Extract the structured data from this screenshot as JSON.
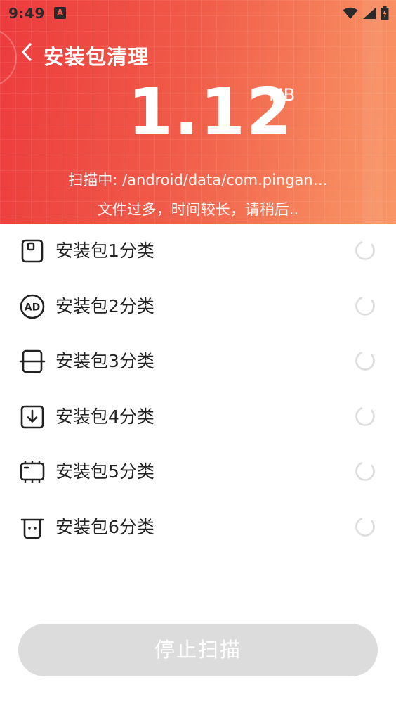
{
  "status_bar": {
    "time": "9:49",
    "app_icon_letter": "A"
  },
  "header": {
    "title": "安装包清理",
    "size_value": "1.12",
    "size_unit": "MB",
    "scan_path": "扫描中: /android/data/com.pingan…",
    "scan_note": "文件过多，时间较长，请稍后.."
  },
  "categories": [
    {
      "label": "安装包1分类",
      "icon": "sd-card-icon"
    },
    {
      "label": "安装包2分类",
      "icon": "ad-icon"
    },
    {
      "label": "安装包3分类",
      "icon": "split-box-icon"
    },
    {
      "label": "安装包4分类",
      "icon": "download-box-icon"
    },
    {
      "label": "安装包5分类",
      "icon": "chip-icon"
    },
    {
      "label": "安装包6分类",
      "icon": "trash-icon"
    }
  ],
  "stop_button": {
    "label": "停止扫描"
  },
  "colors": {
    "header_start": "#ec3b3d",
    "header_end": "#f99566",
    "button_disabled": "#dcdcdc",
    "spinner": "#dddddd"
  }
}
